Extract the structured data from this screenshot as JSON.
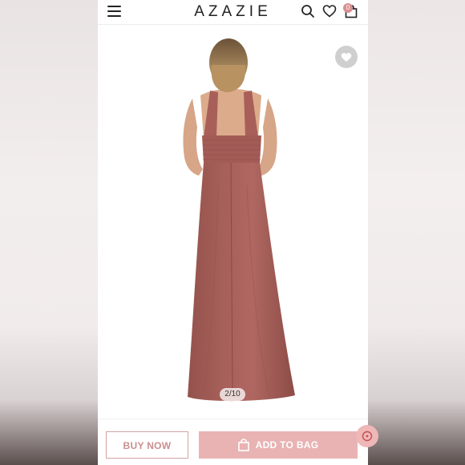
{
  "header": {
    "logo": "AZAZIE",
    "bag_count": "0"
  },
  "gallery": {
    "counter": "2/10",
    "dress_color": "#a85f59"
  },
  "footer": {
    "buy_now_label": "BUY NOW",
    "add_to_bag_label": "ADD TO BAG"
  },
  "colors": {
    "accent": "#e9b3b3",
    "accent_text": "#c98f8f"
  },
  "icons": [
    "hamburger-icon",
    "search-icon",
    "heart-icon",
    "shopping-bag-icon",
    "chat-icon"
  ]
}
